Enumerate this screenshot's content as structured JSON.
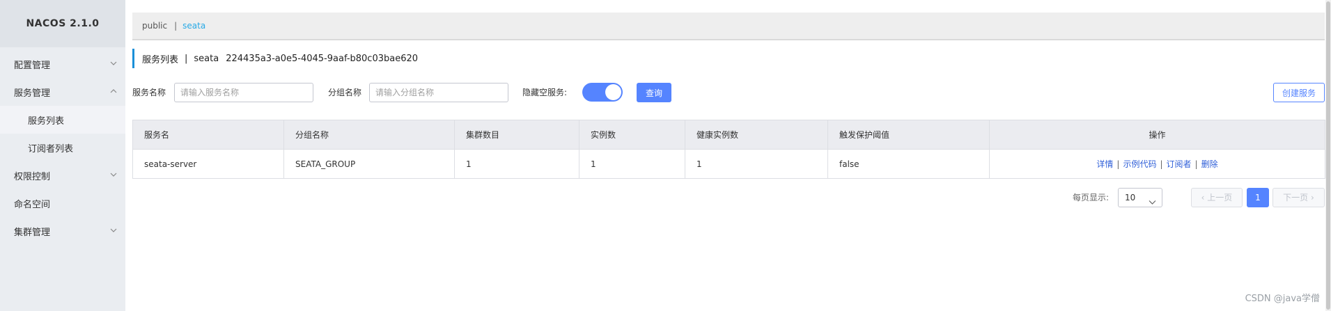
{
  "brand": {
    "title": "NACOS 2.1.0"
  },
  "sidebar": {
    "items": [
      {
        "label": "配置管理",
        "expanded": false
      },
      {
        "label": "服务管理",
        "expanded": true
      },
      {
        "label": "服务列表",
        "sub": true,
        "active": true
      },
      {
        "label": "订阅者列表",
        "sub": true
      },
      {
        "label": "权限控制",
        "expanded": false
      },
      {
        "label": "命名空间"
      },
      {
        "label": "集群管理",
        "expanded": false
      }
    ]
  },
  "namespace_bar": {
    "items": [
      "public",
      "seata"
    ],
    "separator": "|",
    "current": "seata"
  },
  "page_title": {
    "label": "服务列表",
    "separator": "|",
    "namespace": "seata",
    "namespace_id": "224435a3-a0e5-4045-9aaf-b80c03bae620"
  },
  "filters": {
    "service_name_label": "服务名称",
    "service_name_placeholder": "请输入服务名称",
    "group_name_label": "分组名称",
    "group_name_placeholder": "请输入分组名称",
    "hide_empty_label": "隐藏空服务:",
    "hide_empty_on": true,
    "query_label": "查询",
    "create_label": "创建服务"
  },
  "table": {
    "headers": [
      "服务名",
      "分组名称",
      "集群数目",
      "实例数",
      "健康实例数",
      "触发保护阈值",
      "操作"
    ],
    "rows": [
      {
        "service": "seata-server",
        "group": "SEATA_GROUP",
        "clusters": "1",
        "instances": "1",
        "healthy": "1",
        "threshold": "false",
        "actions": [
          "详情",
          "示例代码",
          "订阅者",
          "删除"
        ]
      }
    ]
  },
  "pagination": {
    "page_size_label": "每页显示:",
    "page_size": "10",
    "prev_label": "上一页",
    "current_page": "1",
    "next_label": "下一页"
  },
  "watermark": "CSDN @java学僧",
  "colors": {
    "accent": "#5584ff",
    "link": "#2f5fd8",
    "namespace_active": "#27a9e6",
    "sidebar_bg": "#eaedf1"
  }
}
